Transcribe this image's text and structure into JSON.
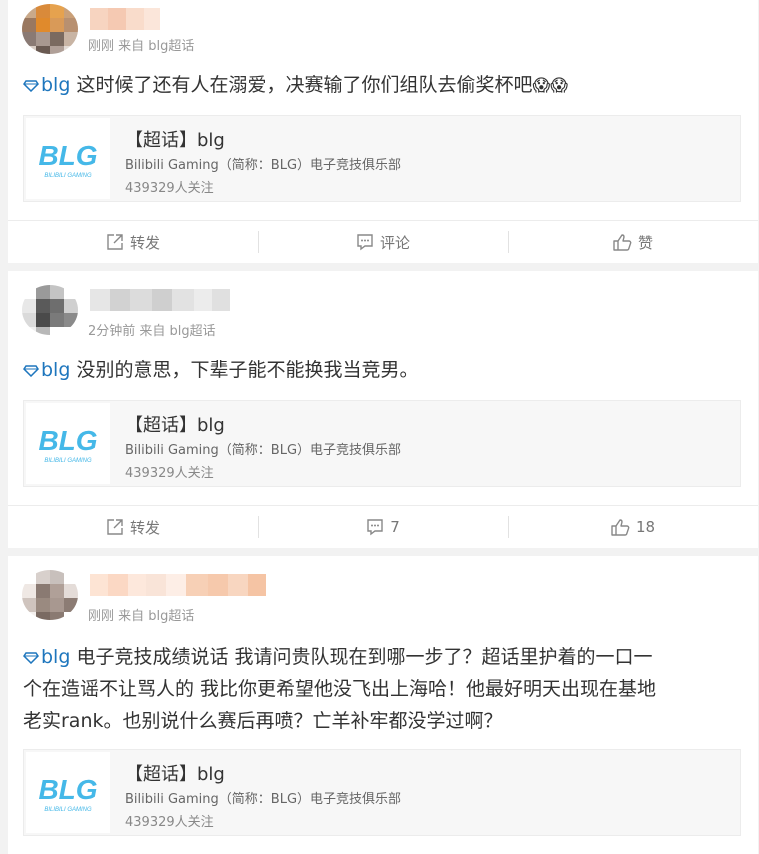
{
  "colors": {
    "topic": "#1e76bd",
    "text": "#333333",
    "meta": "#999999"
  },
  "posts": [
    {
      "meta": "刚刚 来自 blg超话",
      "topic": "blg",
      "text": "这时候了还有人在溺爱，决赛输了你们组队去偷奖杯吧",
      "emoji": "😱😱",
      "card": {
        "title": "【超话】blg",
        "desc": "Bilibili Gaming（简称：BLG）电子竞技俱乐部",
        "followers": "439329人关注"
      },
      "actions": {
        "repost": "转发",
        "comment": "评论",
        "like": "赞"
      }
    },
    {
      "meta": "2分钟前 来自 blg超话",
      "topic": "blg",
      "text": "没别的意思，下辈子能不能换我当竞男。",
      "card": {
        "title": "【超话】blg",
        "desc": "Bilibili Gaming（简称：BLG）电子竞技俱乐部",
        "followers": "439329人关注"
      },
      "actions": {
        "repost": "转发",
        "comment": "7",
        "like": "18"
      }
    },
    {
      "meta": "刚刚 来自 blg超话",
      "topic": "blg",
      "text_line1": "电子竞技成绩说话 我请问贵队现在到哪一步了？超话里护着的一口一",
      "text_line2": "个在造谣不让骂人的 我比你更希望他没飞出上海哈！他最好明天出现在基地",
      "text_line3": "老实rank。也别说什么赛后再喷？亡羊补牢都没学过啊？",
      "card": {
        "title": "【超话】blg",
        "desc": "Bilibili Gaming（简称：BLG）电子竞技俱乐部",
        "followers": "439329人关注"
      }
    }
  ],
  "logo_text": {
    "main": "BLG",
    "sub": "BILIBILI GAMING"
  },
  "icons": {
    "topic": "diamond-icon",
    "repost": "share-icon",
    "comment": "comment-icon",
    "like": "thumbs-up-icon"
  }
}
